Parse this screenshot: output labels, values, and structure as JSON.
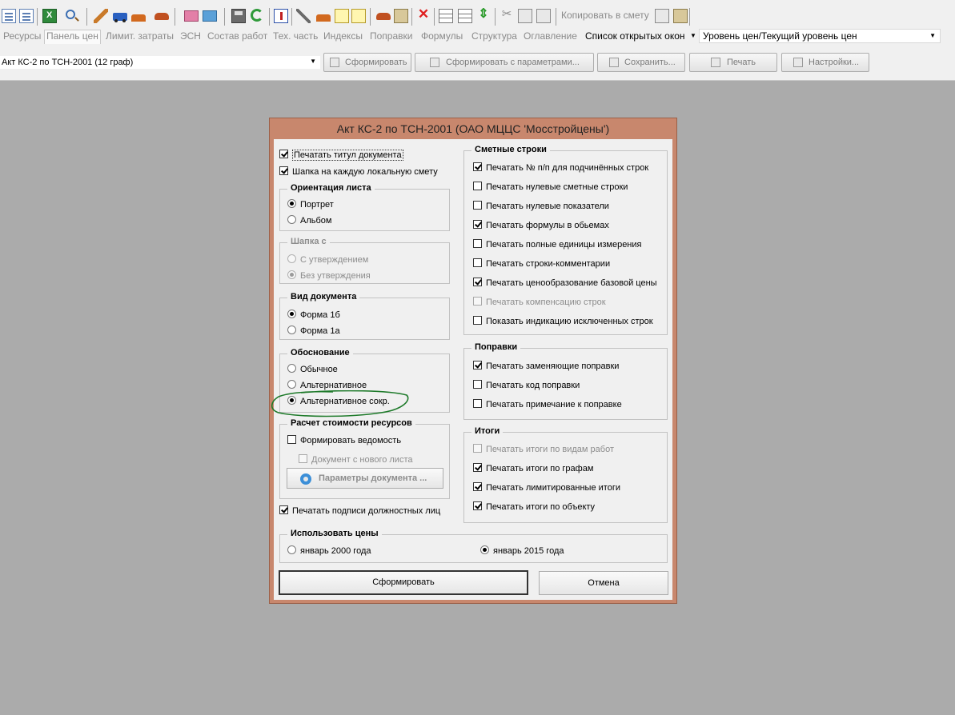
{
  "toolbar": {
    "icons": [
      "document-icon",
      "document-add-icon",
      "excel-icon",
      "magnifier-icon",
      "hammer-icon",
      "truck-icon",
      "brick-icon",
      "car-icon",
      "book-icon",
      "book-stack-icon",
      "save-icon",
      "refresh-icon",
      "document-exclude-icon",
      "tools-icon",
      "stack-icon",
      "export-icon",
      "note-icon",
      "basket-icon",
      "cart-icon",
      "delete-icon",
      "tree-icon",
      "table-icon",
      "move-icon",
      "cut-icon",
      "copy-icon",
      "paste-icon"
    ],
    "copy_to_estimate": "Копировать в смету"
  },
  "menu": {
    "items": [
      "Ресурсы",
      "Панель цен",
      "Лимит. затраты",
      "ЭСН",
      "Состав работ",
      "Тех. часть",
      "Индексы",
      "Поправки",
      "Формулы",
      "Структура",
      "Оглавление"
    ],
    "open_windows": "Список открытых окон",
    "price_level": "Уровень цен/Текущий уровень цен"
  },
  "reportbar": {
    "selected_report": "Акт КС-2 по ТСН-2001 (12 граф)",
    "buttons": [
      "Сформировать",
      "Сформировать с параметрами...",
      "Сохранить...",
      "Печать",
      "Настройки..."
    ]
  },
  "dialog": {
    "title": "Акт КС-2 по ТСН-2001 (ОАО МЦЦС 'Мосстройцены')",
    "top_checks": [
      {
        "label": "Печатать титул документа",
        "checked": true
      },
      {
        "label": "Шапка на каждую локальную смету",
        "checked": true
      }
    ],
    "orientation": {
      "title": "Ориентация листа",
      "options": [
        "Портрет",
        "Альбом"
      ],
      "selected": 0
    },
    "header_with": {
      "title": "Шапка с",
      "options": [
        "С утверждением",
        "Без утверждения"
      ],
      "selected": 1,
      "disabled": true
    },
    "doc_type": {
      "title": "Вид документа",
      "options": [
        "Форма 1б",
        "Форма 1а"
      ],
      "selected": 0
    },
    "justification": {
      "title": "Обоснование",
      "options": [
        "Обычное",
        "Альтернативное",
        "Альтернативное сокр."
      ],
      "selected": 2
    },
    "resource_cost": {
      "title": "Расчет стоимости ресурсов",
      "form_statement": {
        "label": "Формировать ведомость",
        "checked": false
      },
      "new_sheet": {
        "label": "Документ с нового листа",
        "checked": false,
        "disabled": true
      },
      "params_button": "Параметры документа ..."
    },
    "print_signatures": {
      "label": "Печатать подписи должностных лиц",
      "checked": true
    },
    "estimate_lines": {
      "title": "Сметные строки",
      "items": [
        {
          "label": "Печатать № п/п для подчинённых строк",
          "checked": true,
          "disabled": false
        },
        {
          "label": "Печатать нулевые сметные строки",
          "checked": false,
          "disabled": false
        },
        {
          "label": "Печатать нулевые показатели",
          "checked": false,
          "disabled": false
        },
        {
          "label": "Печатать формулы в обьемах",
          "checked": true,
          "disabled": false
        },
        {
          "label": "Печатать полные единицы измерения",
          "checked": false,
          "disabled": false
        },
        {
          "label": "Печатать строки-комментарии",
          "checked": false,
          "disabled": false
        },
        {
          "label": "Печатать ценообразование базовой цены",
          "checked": true,
          "disabled": false
        },
        {
          "label": "Печатать компенсацию строк",
          "checked": false,
          "disabled": true
        },
        {
          "label": "Показать индикацию исключенных строк",
          "checked": false,
          "disabled": false
        }
      ]
    },
    "corrections": {
      "title": "Поправки",
      "items": [
        {
          "label": "Печатать заменяющие поправки",
          "checked": true
        },
        {
          "label": "Печатать код поправки",
          "checked": false
        },
        {
          "label": "Печатать примечание к поправке",
          "checked": false
        }
      ]
    },
    "totals": {
      "title": "Итоги",
      "items": [
        {
          "label": "Печатать итоги по видам работ",
          "checked": false,
          "disabled": true
        },
        {
          "label": "Печатать итоги по графам",
          "checked": true,
          "disabled": false
        },
        {
          "label": "Печатать лимитированные итоги",
          "checked": true,
          "disabled": false
        },
        {
          "label": "Печатать итоги по объекту",
          "checked": true,
          "disabled": false
        }
      ]
    },
    "use_prices": {
      "title": "Использовать цены",
      "options": [
        "январь 2000 года",
        "январь 2015 года"
      ],
      "selected": 1
    },
    "buttons": {
      "ok": "Сформировать",
      "cancel": "Отмена"
    }
  },
  "annotation": {
    "color": "#1e7a2a"
  }
}
